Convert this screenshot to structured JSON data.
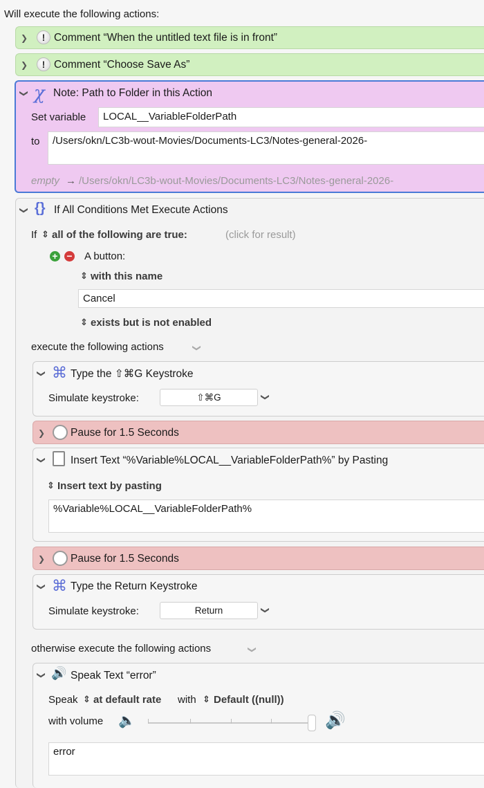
{
  "header": "Will execute the following actions:",
  "comment1": {
    "label": "Comment “When the untitled text file is in front”"
  },
  "comment2": {
    "label": "Comment “Choose Save As”"
  },
  "note": {
    "title": "Note: Path to Folder in this Action",
    "set_label": "Set variable",
    "variable_name": "LOCAL__VariableFolderPath",
    "to_label": "to",
    "to_value": "/Users/okn/LC3b-wout-Movies/Documents-LC3/Notes-general-2026-",
    "preview_empty": "empty",
    "preview_arrow": "→",
    "preview_path": "/Users/okn/LC3b-wout-Movies/Documents-LC3/Notes-general-2026-"
  },
  "if_block": {
    "title": "If All Conditions Met Execute Actions",
    "if_label": "If",
    "condition_mode": "all of the following are true:",
    "result_hint": "(click for result)",
    "button_label": "A button:",
    "name_mode": "with this name",
    "name_value": "Cancel",
    "state_mode": "exists but is not enabled",
    "then_label": "execute the following actions",
    "else_label": "otherwise execute the following actions"
  },
  "actions": {
    "type1": {
      "title": "Type the ⇧⌘G Keystroke",
      "sim_label": "Simulate keystroke:",
      "key": "⇧⌘G"
    },
    "pause1": {
      "title": "Pause for 1.5 Seconds"
    },
    "insert": {
      "title": "Insert Text “%Variable%LOCAL__VariableFolderPath%” by Pasting",
      "mode": "Insert text by pasting",
      "value": "%Variable%LOCAL__VariableFolderPath%"
    },
    "pause2": {
      "title": "Pause for 1.5 Seconds"
    },
    "type2": {
      "title": "Type the Return Keystroke",
      "sim_label": "Simulate keystroke:",
      "key": "Return"
    },
    "speak": {
      "title": "Speak Text “error”",
      "speak_label": "Speak",
      "rate": "at default rate",
      "with_label": "with",
      "voice": "Default ((null))",
      "volume_label": "with volume",
      "volume_level": 1.0,
      "text": "error"
    }
  },
  "colors": {
    "comment_bg": "#d1f0c0",
    "note_bg": "#efc9f1",
    "pause_bg": "#eec1c1",
    "selection_border": "#4a7ad6",
    "plus_button": "#3aa13a",
    "minus_button": "#d43b3b"
  },
  "icons": [
    "chevron-right-icon",
    "chevron-down-icon",
    "exclamation-icon",
    "variable-x-icon",
    "braces-icon",
    "command-key-icon",
    "clock-icon",
    "clipboard-icon",
    "speaker-icon",
    "stepper-icon"
  ]
}
